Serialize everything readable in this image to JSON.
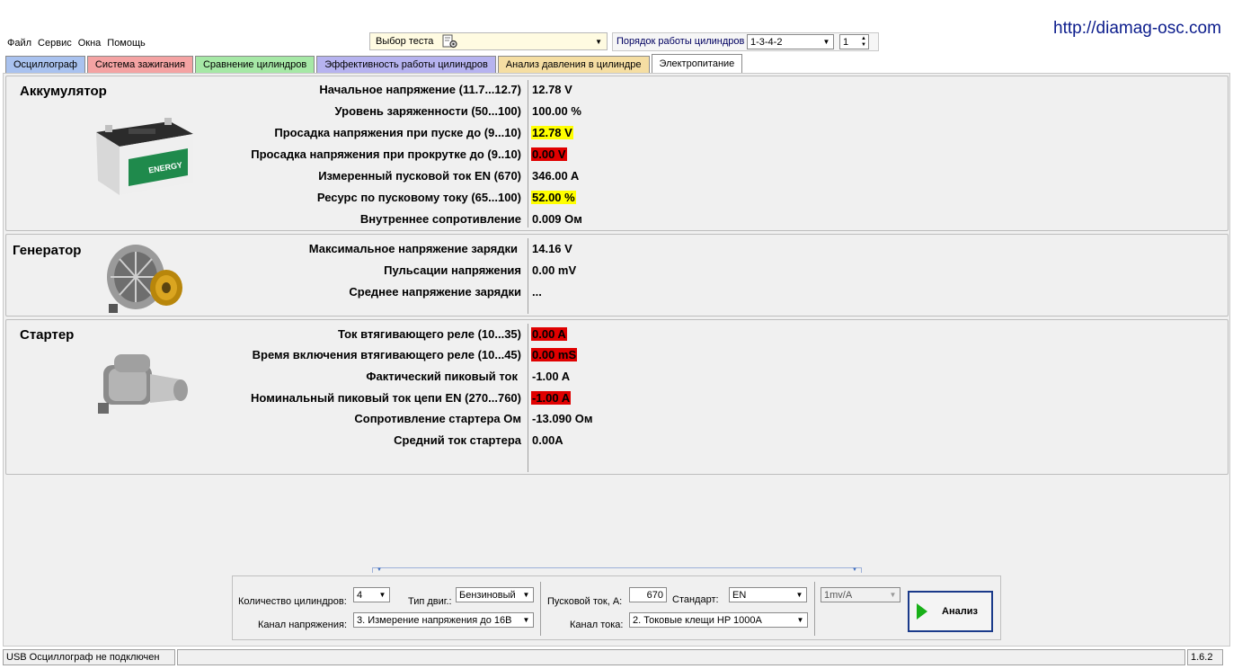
{
  "url_text": "http://diamag-osc.com",
  "menu": [
    "Файл",
    "Сервис",
    "Окна",
    "Помощь"
  ],
  "test_select": {
    "label": "Выбор теста"
  },
  "cylinder_order": {
    "label": "Порядок работы цилиндров",
    "value": "1-3-4-2",
    "spin_value": "1"
  },
  "tabs": [
    {
      "label": "Осциллограф",
      "color": "#a9c2ef"
    },
    {
      "label": "Система зажигания",
      "color": "#f4a3a3"
    },
    {
      "label": "Сравнение цилиндров",
      "color": "#a6e8a6"
    },
    {
      "label": "Эффективность работы цилиндров",
      "color": "#b6b3ef"
    },
    {
      "label": "Анализ давления в цилиндре",
      "color": "#f5dea3"
    },
    {
      "label": "Электропитание",
      "color": "#ffffff",
      "active": true
    }
  ],
  "battery": {
    "title": "Аккумулятор",
    "image": "car-battery-image",
    "image_brand_text": "ENERGY",
    "params": [
      {
        "label": "Начальное напряжение (11.7...12.7)",
        "value": "12.78 V",
        "highlight": ""
      },
      {
        "label": "Уровень заряженности (50...100)",
        "value": "100.00 %",
        "highlight": ""
      },
      {
        "label": "Просадка напряжения при пуске до (9...10)",
        "value": "12.78 V",
        "highlight": "#ffff00"
      },
      {
        "label": "Просадка напряжения при прокрутке до  (9..10)",
        "value": "0.00 V",
        "highlight": "#e00000"
      },
      {
        "label": "Измеренный пусковой ток  EN (670)",
        "value": "346.00 A",
        "highlight": ""
      },
      {
        "label": "Ресурс по пусковому току (65...100)",
        "value": "52.00 %",
        "highlight": "#ffff00"
      },
      {
        "label": "Внутреннее сопротивление",
        "value": "0.009 Ом",
        "highlight": ""
      }
    ]
  },
  "generator": {
    "title": "Генератор",
    "image": "alternator-image",
    "params": [
      {
        "label": "Максимальное напряжение зарядки",
        "value": "14.16 V",
        "highlight": ""
      },
      {
        "label": "Пульсации напряжения",
        "value": "0.00 mV",
        "highlight": ""
      },
      {
        "label": "Среднее напряжение зарядки",
        "value": "...",
        "highlight": ""
      }
    ]
  },
  "starter": {
    "title": "Стартер",
    "image": "starter-motor-image",
    "params": [
      {
        "label": "Ток втягивающего реле (10...35)",
        "value": "0.00 A",
        "highlight": "#e00000"
      },
      {
        "label": "Время включения втягивающего реле (10...45)",
        "value": "0.00 mS",
        "highlight": "#e00000"
      },
      {
        "label": "Фактический пиковый ток",
        "value": "-1.00 A",
        "highlight": ""
      },
      {
        "label": "Номинальный пиковый ток цепи EN (270...760)",
        "value": "-1.00 A",
        "highlight": "#e00000"
      },
      {
        "label": "Сопротивление стартера Ом",
        "value": "-13.090 Ом",
        "highlight": ""
      },
      {
        "label": "Средний ток стартера",
        "value": "0.00A",
        "highlight": ""
      }
    ]
  },
  "settings": {
    "cylinders_label": "Количество цилиндров:",
    "cylinders_value": "4",
    "engine_type_label": "Тип двиг.:",
    "engine_type_value": "Бензиновый",
    "voltage_channel_label": "Канал напряжения:",
    "voltage_channel_value": "3.  Измерение напряжения до 16В",
    "start_current_label": "Пусковой ток, А:",
    "start_current_value": "670",
    "standard_label": "Стандарт:",
    "standard_value": "EN",
    "current_channel_label": "Канал тока:",
    "current_channel_value": "2.  Токовые клещи HP 1000A",
    "scale_value": "1mv/A",
    "analyze_label": "Анализ"
  },
  "status": {
    "connection": "USB Осциллограф не подключен",
    "version": "1.6.2"
  }
}
